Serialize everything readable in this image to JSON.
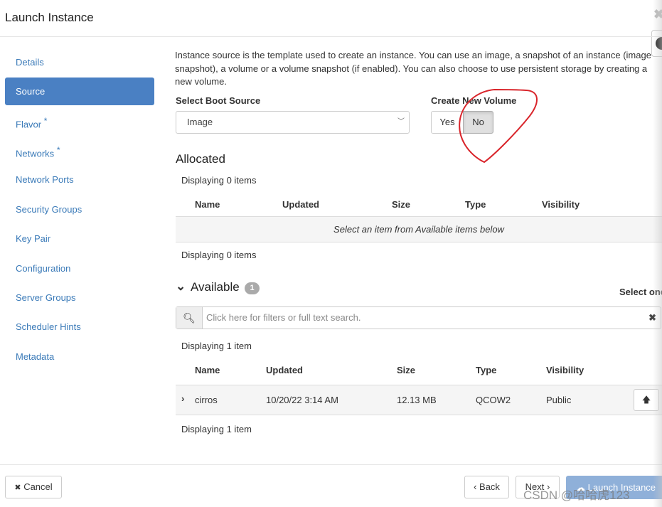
{
  "title": "Launch Instance",
  "sidebar": {
    "items": [
      {
        "label": "Details",
        "required": ""
      },
      {
        "label": "Source",
        "required": ""
      },
      {
        "label": "Flavor",
        "required": "*"
      },
      {
        "label": "Networks",
        "required": "*"
      },
      {
        "label": "Network Ports",
        "required": ""
      },
      {
        "label": "Security Groups",
        "required": ""
      },
      {
        "label": "Key Pair",
        "required": ""
      },
      {
        "label": "Configuration",
        "required": ""
      },
      {
        "label": "Server Groups",
        "required": ""
      },
      {
        "label": "Scheduler Hints",
        "required": ""
      },
      {
        "label": "Metadata",
        "required": ""
      }
    ],
    "active": "Source"
  },
  "intro": "Instance source is the template used to create an instance. You can use an image, a snapshot of an instance (image snapshot), a volume or a volume snapshot (if enabled). You can also choose to use persistent storage by creating a new volume.",
  "boot_source": {
    "label": "Select Boot Source",
    "value": "Image"
  },
  "create_volume": {
    "label": "Create New Volume",
    "yes": "Yes",
    "no": "No",
    "selected": "No"
  },
  "allocated": {
    "title": "Allocated",
    "count_top": "Displaying 0 items",
    "count_bottom": "Displaying 0 items",
    "columns": [
      "Name",
      "Updated",
      "Size",
      "Type",
      "Visibility"
    ],
    "empty": "Select an item from Available items below"
  },
  "available": {
    "title": "Available",
    "badge": "1",
    "select_one": "Select one",
    "search_placeholder": "Click here for filters or full text search.",
    "count_top": "Displaying 1 item",
    "count_bottom": "Displaying 1 item",
    "columns": [
      "Name",
      "Updated",
      "Size",
      "Type",
      "Visibility"
    ],
    "rows": [
      {
        "name": "cirros",
        "updated": "10/20/22 3:14 AM",
        "size": "12.13 MB",
        "type": "QCOW2",
        "visibility": "Public"
      }
    ]
  },
  "footer": {
    "cancel": "Cancel",
    "back": "Back",
    "next": "Next",
    "launch": "Launch Instance"
  },
  "watermark": "CSDN @哈哈虎123",
  "colors": {
    "accent": "#4a80c3",
    "annotation": "#d9252b"
  }
}
